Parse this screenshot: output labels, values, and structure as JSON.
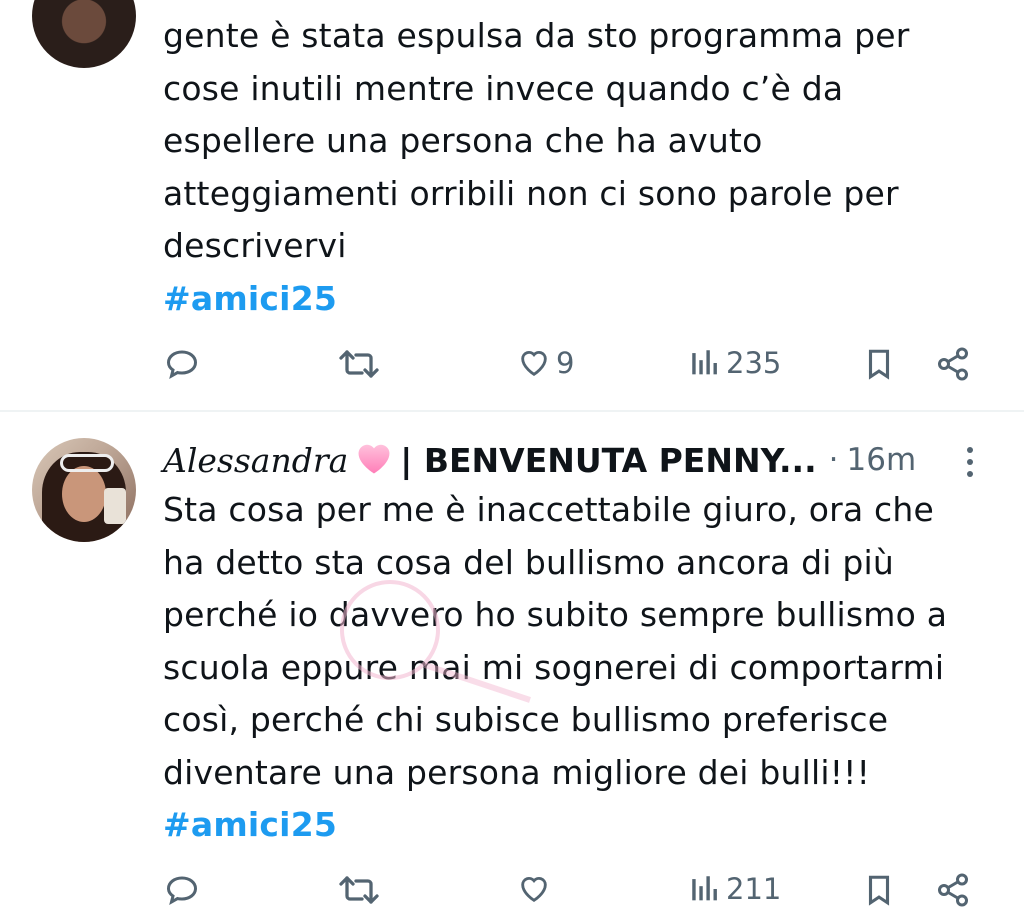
{
  "tweet1": {
    "lines": [
      "gente è stata espulsa da sto programma per",
      "cose inutili mentre invece quando c’è da",
      "espellere una persona che ha avuto",
      "atteggiamenti orribili non ci sono parole per",
      "descrivervi"
    ],
    "hashtag": "#amici25",
    "likes": "9",
    "views": "235"
  },
  "tweet2": {
    "author_script": "Alessandra",
    "author_emoji": "pink-heart",
    "author_rest": "| BENVENUTA PENNY...",
    "separator": "·",
    "time": "16m",
    "lines": [
      "Sta cosa per me è inaccettabile giuro, ora che",
      "ha detto sta cosa del bullismo ancora di più",
      "perché io davvero ho subito sempre bullismo a",
      "scuola eppure mai mi sognerei di comportarmi",
      "così, perché chi subisce bullismo preferisce",
      "diventare una persona migliore dei bulli!!!"
    ],
    "hashtag": "#amici25",
    "views": "211"
  },
  "colors": {
    "link": "#1d9bf0",
    "icon": "#536471",
    "text": "#0f1419",
    "divider": "#eff3f4",
    "heart": "#ff8fc4"
  }
}
